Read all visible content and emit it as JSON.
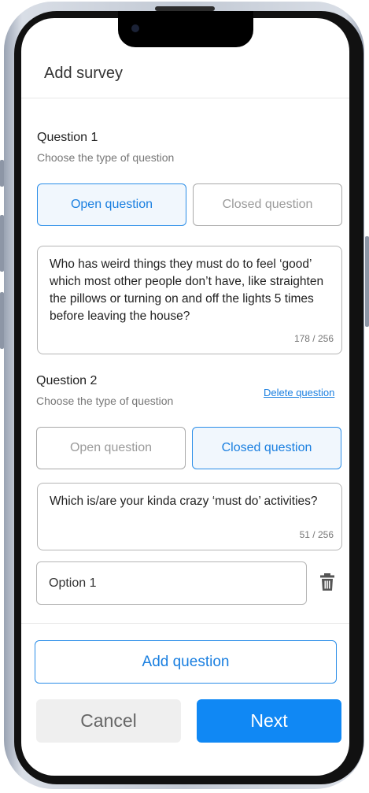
{
  "header": {
    "title": "Add survey"
  },
  "question1": {
    "label": "Question 1",
    "subtitle": "Choose the type of question",
    "open_label": "Open question",
    "closed_label": "Closed question",
    "selected": "open",
    "text": "Who has weird things they must do to feel ‘good’ which most other people don’t have, like  straighten the pillows or turning on and off the lights 5 times before leaving the house?",
    "counter": "178 / 256"
  },
  "question2": {
    "label": "Question 2",
    "subtitle": "Choose the type of question",
    "delete_label": "Delete question",
    "open_label": "Open question",
    "closed_label": "Closed question",
    "selected": "closed",
    "text": "Which is/are your kinda crazy ‘must do’ activities?",
    "counter": "51 / 256",
    "option1_placeholder": "Option 1"
  },
  "footer": {
    "add_question_label": "Add question",
    "cancel_label": "Cancel",
    "next_label": "Next"
  },
  "colors": {
    "accent": "#1088f4",
    "selected_bg": "#f1f7fd",
    "border": "#b5b5b5"
  },
  "icons": {
    "delete_option": "trash-icon"
  }
}
